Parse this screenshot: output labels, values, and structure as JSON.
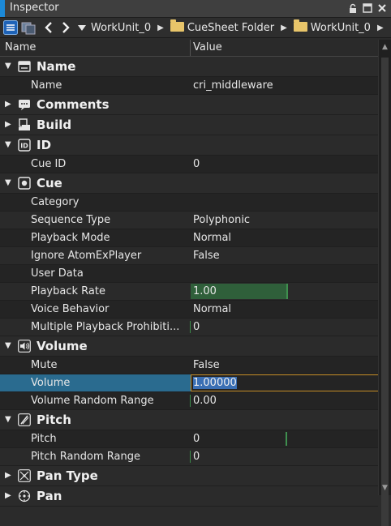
{
  "window": {
    "title": "Inspector"
  },
  "breadcrumb": {
    "items": [
      {
        "label": "WorkUnit_0",
        "folder": false
      },
      {
        "label": "CueSheet Folder",
        "folder": true
      },
      {
        "label": "WorkUnit_0",
        "folder": true
      }
    ]
  },
  "header": {
    "name_col": "Name",
    "value_col": "Value"
  },
  "groups": {
    "name": {
      "label": "Name",
      "icon": "tag-icon",
      "expanded": true
    },
    "comments": {
      "label": "Comments",
      "icon": "comment-icon",
      "expanded": false
    },
    "build": {
      "label": "Build",
      "icon": "build-icon",
      "expanded": false
    },
    "id": {
      "label": "ID",
      "icon": "id-icon",
      "expanded": true
    },
    "cue": {
      "label": "Cue",
      "icon": "cue-icon",
      "expanded": true
    },
    "volume": {
      "label": "Volume",
      "icon": "speaker-icon",
      "expanded": true
    },
    "pitch": {
      "label": "Pitch",
      "icon": "pitch-icon",
      "expanded": true
    },
    "pantype": {
      "label": "Pan Type",
      "icon": "pan-type-icon",
      "expanded": false
    },
    "pan": {
      "label": "Pan",
      "icon": "pan-icon",
      "expanded": false
    }
  },
  "props": {
    "name": {
      "label": "Name",
      "value": "cri_middleware"
    },
    "cue_id": {
      "label": "Cue ID",
      "value": "0"
    },
    "category": {
      "label": "Category",
      "value": ""
    },
    "sequence_type": {
      "label": "Sequence Type",
      "value": "Polyphonic"
    },
    "playback_mode": {
      "label": "Playback Mode",
      "value": "Normal"
    },
    "ignore_player": {
      "label": "Ignore AtomExPlayer",
      "value": "False"
    },
    "user_data": {
      "label": "User Data",
      "value": ""
    },
    "playback_rate": {
      "label": "Playback Rate",
      "value": "1.00"
    },
    "voice_behavior": {
      "label": "Voice Behavior",
      "value": "Normal"
    },
    "multi_prohibit": {
      "label": "Multiple Playback Prohibiti...",
      "value": "0"
    },
    "mute": {
      "label": "Mute",
      "value": "False"
    },
    "volume": {
      "label": "Volume",
      "value": "1.00000"
    },
    "volume_random": {
      "label": "Volume Random Range",
      "value": "0.00"
    },
    "pitch": {
      "label": "Pitch",
      "value": "0"
    },
    "pitch_random": {
      "label": "Pitch Random Range",
      "value": "0"
    }
  }
}
